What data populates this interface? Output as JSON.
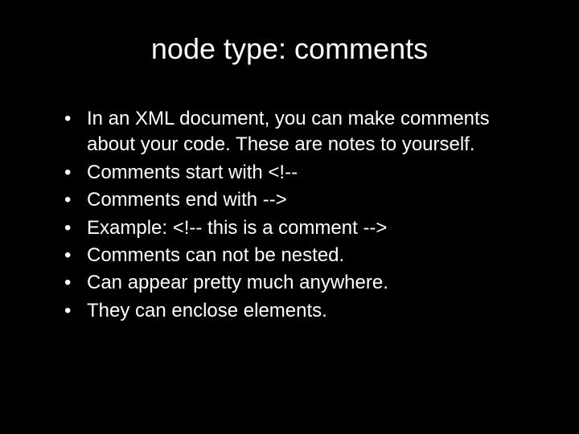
{
  "slide": {
    "title": "node type: comments",
    "bullets": [
      "In an XML document, you can make comments about your code. These are notes to yourself.",
      "Comments start with <!--",
      "Comments end with -->",
      "Example: <!-- this is a comment -->",
      "Comments can not be nested.",
      "Can appear pretty much anywhere.",
      "They can enclose elements."
    ]
  }
}
